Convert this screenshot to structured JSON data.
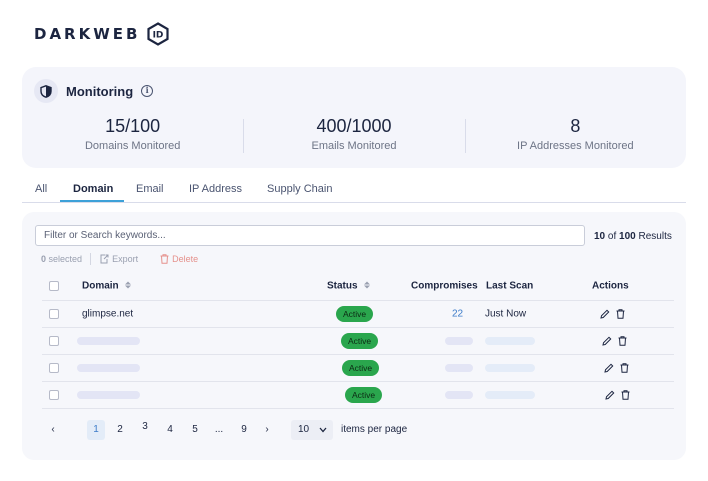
{
  "logo": {
    "text": "DARKWEB",
    "badge": "ID"
  },
  "monitoring": {
    "title": "Monitoring",
    "stats": [
      {
        "value": "15/100",
        "label": "Domains Monitored"
      },
      {
        "value": "400/1000",
        "label": "Emails Monitored"
      },
      {
        "value": "8",
        "label": "IP Addresses Monitored"
      }
    ]
  },
  "tabs": [
    {
      "label": "All",
      "active": false
    },
    {
      "label": "Domain",
      "active": true
    },
    {
      "label": "Email",
      "active": false
    },
    {
      "label": "IP Address",
      "active": false
    },
    {
      "label": "Supply Chain",
      "active": false
    }
  ],
  "search": {
    "placeholder": "Filter or Search keywords..."
  },
  "results": {
    "shown": "10",
    "of": "of",
    "total": "100",
    "suffix": "Results"
  },
  "bulk": {
    "selected_count": "0",
    "selected_label": "selected",
    "export": "Export",
    "delete": "Delete"
  },
  "table": {
    "headers": {
      "domain": "Domain",
      "status": "Status",
      "compromises": "Compromises",
      "last_scan": "Last Scan",
      "actions": "Actions"
    },
    "rows": [
      {
        "domain": "glimpse.net",
        "status": "Active",
        "compromises": "22",
        "last_scan": "Just Now"
      },
      {
        "domain": "",
        "status": "Active",
        "compromises": "",
        "last_scan": ""
      },
      {
        "domain": "",
        "status": "Active",
        "compromises": "",
        "last_scan": ""
      },
      {
        "domain": "",
        "status": "Active",
        "compromises": "",
        "last_scan": ""
      }
    ]
  },
  "pagination": {
    "prev": "‹",
    "pages": [
      "1",
      "2",
      "3",
      "4",
      "5",
      "...",
      "9"
    ],
    "current": "1",
    "next": "›",
    "per_page": "10",
    "per_page_label": "items per page"
  },
  "colors": {
    "accent": "#3da1d8",
    "active_pill": "#2aa64d",
    "link": "#3d7cc9",
    "delete": "#e5918c"
  },
  "icons": [
    "shield-icon",
    "info-icon",
    "export-icon",
    "trash-icon",
    "sort-icon",
    "pencil-icon",
    "chevron-left-icon",
    "chevron-right-icon",
    "chevron-down-icon"
  ]
}
